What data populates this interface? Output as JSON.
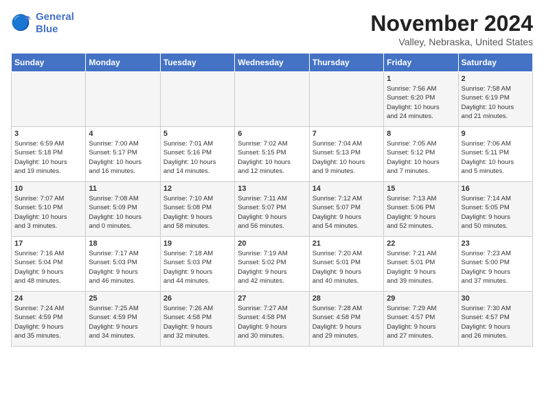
{
  "header": {
    "logo_line1": "General",
    "logo_line2": "Blue",
    "month": "November 2024",
    "location": "Valley, Nebraska, United States"
  },
  "weekdays": [
    "Sunday",
    "Monday",
    "Tuesday",
    "Wednesday",
    "Thursday",
    "Friday",
    "Saturday"
  ],
  "weeks": [
    [
      {
        "day": "",
        "info": ""
      },
      {
        "day": "",
        "info": ""
      },
      {
        "day": "",
        "info": ""
      },
      {
        "day": "",
        "info": ""
      },
      {
        "day": "",
        "info": ""
      },
      {
        "day": "1",
        "info": "Sunrise: 7:56 AM\nSunset: 6:20 PM\nDaylight: 10 hours\nand 24 minutes."
      },
      {
        "day": "2",
        "info": "Sunrise: 7:58 AM\nSunset: 6:19 PM\nDaylight: 10 hours\nand 21 minutes."
      }
    ],
    [
      {
        "day": "3",
        "info": "Sunrise: 6:59 AM\nSunset: 5:18 PM\nDaylight: 10 hours\nand 19 minutes."
      },
      {
        "day": "4",
        "info": "Sunrise: 7:00 AM\nSunset: 5:17 PM\nDaylight: 10 hours\nand 16 minutes."
      },
      {
        "day": "5",
        "info": "Sunrise: 7:01 AM\nSunset: 5:16 PM\nDaylight: 10 hours\nand 14 minutes."
      },
      {
        "day": "6",
        "info": "Sunrise: 7:02 AM\nSunset: 5:15 PM\nDaylight: 10 hours\nand 12 minutes."
      },
      {
        "day": "7",
        "info": "Sunrise: 7:04 AM\nSunset: 5:13 PM\nDaylight: 10 hours\nand 9 minutes."
      },
      {
        "day": "8",
        "info": "Sunrise: 7:05 AM\nSunset: 5:12 PM\nDaylight: 10 hours\nand 7 minutes."
      },
      {
        "day": "9",
        "info": "Sunrise: 7:06 AM\nSunset: 5:11 PM\nDaylight: 10 hours\nand 5 minutes."
      }
    ],
    [
      {
        "day": "10",
        "info": "Sunrise: 7:07 AM\nSunset: 5:10 PM\nDaylight: 10 hours\nand 3 minutes."
      },
      {
        "day": "11",
        "info": "Sunrise: 7:08 AM\nSunset: 5:09 PM\nDaylight: 10 hours\nand 0 minutes."
      },
      {
        "day": "12",
        "info": "Sunrise: 7:10 AM\nSunset: 5:08 PM\nDaylight: 9 hours\nand 58 minutes."
      },
      {
        "day": "13",
        "info": "Sunrise: 7:11 AM\nSunset: 5:07 PM\nDaylight: 9 hours\nand 56 minutes."
      },
      {
        "day": "14",
        "info": "Sunrise: 7:12 AM\nSunset: 5:07 PM\nDaylight: 9 hours\nand 54 minutes."
      },
      {
        "day": "15",
        "info": "Sunrise: 7:13 AM\nSunset: 5:06 PM\nDaylight: 9 hours\nand 52 minutes."
      },
      {
        "day": "16",
        "info": "Sunrise: 7:14 AM\nSunset: 5:05 PM\nDaylight: 9 hours\nand 50 minutes."
      }
    ],
    [
      {
        "day": "17",
        "info": "Sunrise: 7:16 AM\nSunset: 5:04 PM\nDaylight: 9 hours\nand 48 minutes."
      },
      {
        "day": "18",
        "info": "Sunrise: 7:17 AM\nSunset: 5:03 PM\nDaylight: 9 hours\nand 46 minutes."
      },
      {
        "day": "19",
        "info": "Sunrise: 7:18 AM\nSunset: 5:03 PM\nDaylight: 9 hours\nand 44 minutes."
      },
      {
        "day": "20",
        "info": "Sunrise: 7:19 AM\nSunset: 5:02 PM\nDaylight: 9 hours\nand 42 minutes."
      },
      {
        "day": "21",
        "info": "Sunrise: 7:20 AM\nSunset: 5:01 PM\nDaylight: 9 hours\nand 40 minutes."
      },
      {
        "day": "22",
        "info": "Sunrise: 7:21 AM\nSunset: 5:01 PM\nDaylight: 9 hours\nand 39 minutes."
      },
      {
        "day": "23",
        "info": "Sunrise: 7:23 AM\nSunset: 5:00 PM\nDaylight: 9 hours\nand 37 minutes."
      }
    ],
    [
      {
        "day": "24",
        "info": "Sunrise: 7:24 AM\nSunset: 4:59 PM\nDaylight: 9 hours\nand 35 minutes."
      },
      {
        "day": "25",
        "info": "Sunrise: 7:25 AM\nSunset: 4:59 PM\nDaylight: 9 hours\nand 34 minutes."
      },
      {
        "day": "26",
        "info": "Sunrise: 7:26 AM\nSunset: 4:58 PM\nDaylight: 9 hours\nand 32 minutes."
      },
      {
        "day": "27",
        "info": "Sunrise: 7:27 AM\nSunset: 4:58 PM\nDaylight: 9 hours\nand 30 minutes."
      },
      {
        "day": "28",
        "info": "Sunrise: 7:28 AM\nSunset: 4:58 PM\nDaylight: 9 hours\nand 29 minutes."
      },
      {
        "day": "29",
        "info": "Sunrise: 7:29 AM\nSunset: 4:57 PM\nDaylight: 9 hours\nand 27 minutes."
      },
      {
        "day": "30",
        "info": "Sunrise: 7:30 AM\nSunset: 4:57 PM\nDaylight: 9 hours\nand 26 minutes."
      }
    ]
  ]
}
